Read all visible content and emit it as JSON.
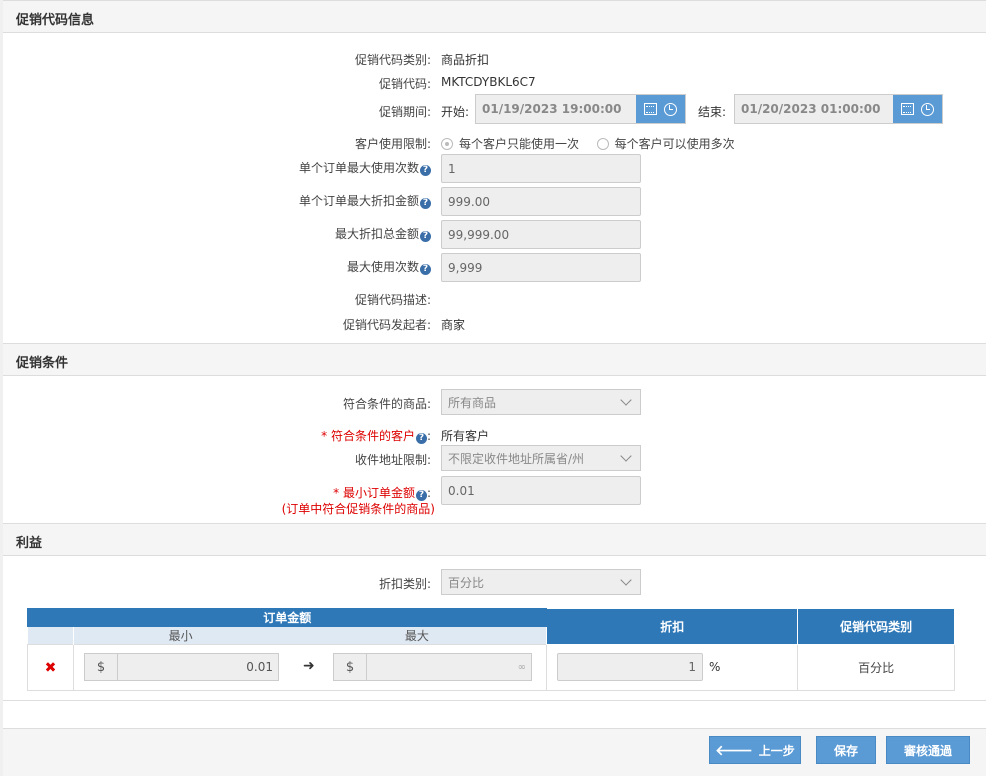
{
  "section_info": {
    "title": "促销代码信息",
    "type_label": "促销代码类别:",
    "type_value": "商品折扣",
    "code_label": "促销代码:",
    "code_value": "MKTCDYBKL6C7",
    "period_label": "促销期间:",
    "start_label": "开始:",
    "start_value": "01/19/2023 19:00:00",
    "end_label": "结束:",
    "end_value": "01/20/2023 01:00:00",
    "usage_limit_label": "客户使用限制:",
    "usage_option_once": "每个客户只能使用一次",
    "usage_option_multi": "每个客户可以使用多次",
    "max_uses_per_order_label": "单个订单最大使用次数",
    "max_uses_per_order_value": "1",
    "max_discount_per_order_label": "单个订单最大折扣金额",
    "max_discount_per_order_value": "999.00",
    "max_total_discount_label": "最大折扣总金额",
    "max_total_discount_value": "99,999.00",
    "max_uses_label": "最大使用次数",
    "max_uses_value": "9,999",
    "description_label": "促销代码描述:",
    "initiator_label": "促销代码发起者:",
    "initiator_value": "商家"
  },
  "section_conditions": {
    "title": "促销条件",
    "products_label": "符合条件的商品:",
    "products_value": "所有商品",
    "customers_label": "符合条件的客户",
    "customers_value": "所有客户",
    "address_label": "收件地址限制:",
    "address_value": "不限定收件地址所属省/州",
    "min_order_label": "最小订单金额",
    "min_order_note": "(订单中符合促销条件的商品)",
    "min_order_value": "0.01"
  },
  "section_benefit": {
    "title": "利益",
    "discount_type_label": "折扣类别:",
    "discount_type_value": "百分比",
    "table": {
      "col_order_amount": "订单金额",
      "col_min": "最小",
      "col_max": "最大",
      "col_discount": "折扣",
      "col_code_type": "促销代码类别",
      "row": {
        "currency": "$",
        "min_value": "0.01",
        "max_value": "∞",
        "discount_value": "1",
        "percent_sign": "%",
        "code_type": "百分比"
      }
    }
  },
  "footer": {
    "back_label": "上一步",
    "save_label": "保存",
    "approve_label": "審核通過"
  },
  "colors": {
    "accent": "#5b9bd5",
    "table_header": "#2e78b8",
    "required": "#dd0000"
  }
}
